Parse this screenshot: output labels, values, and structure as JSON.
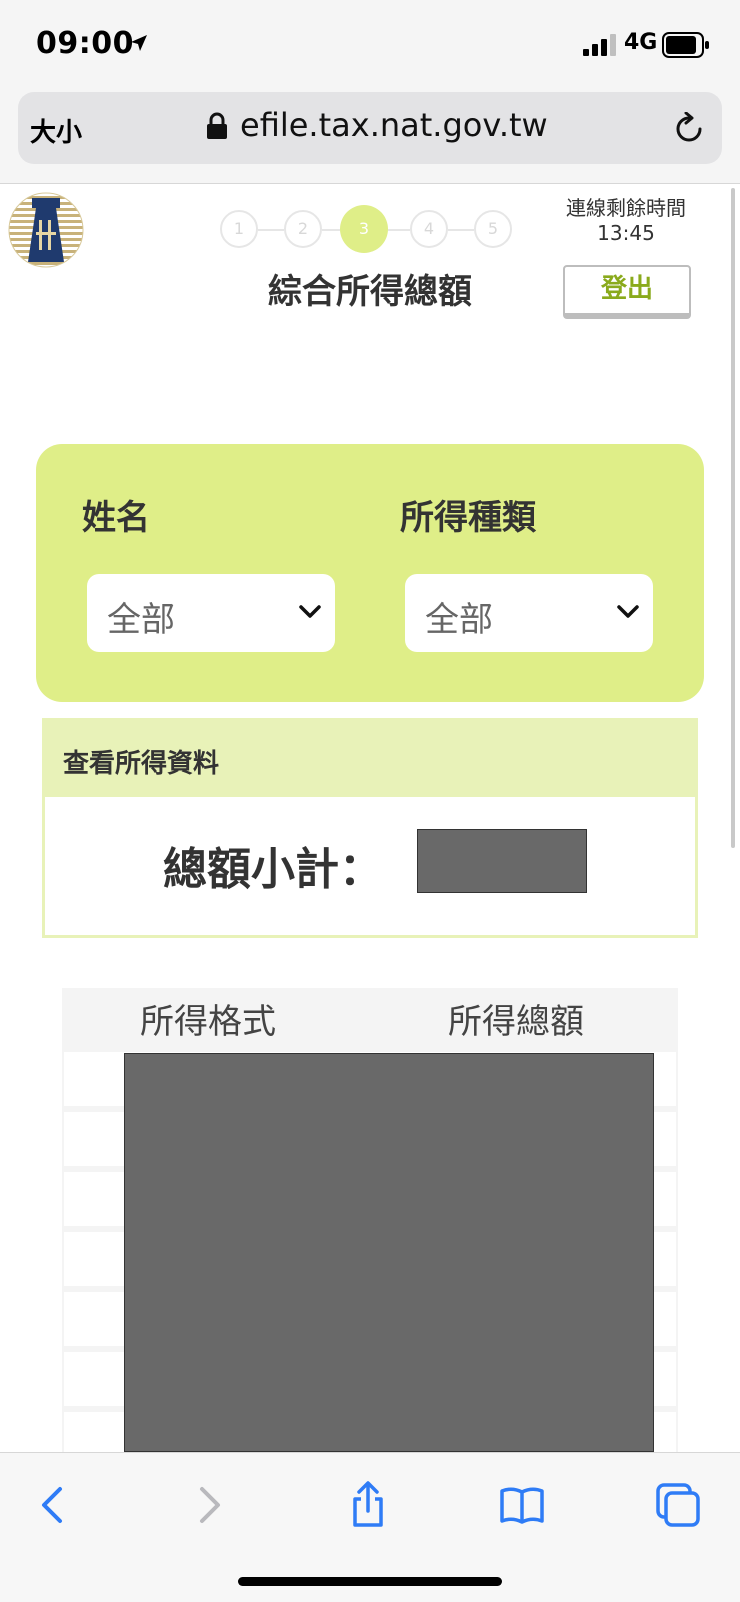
{
  "status_bar": {
    "time": "09:00",
    "network": "4G"
  },
  "browser": {
    "text_size_label": "大小",
    "url": "efile.tax.nat.gov.tw"
  },
  "page": {
    "steps": [
      "1",
      "2",
      "3",
      "4",
      "5"
    ],
    "active_step": 3,
    "title": "綜合所得總額",
    "session_label": "連線剩餘時間",
    "session_remaining": "13:45",
    "logout_label": "登出"
  },
  "filters": {
    "name_label": "姓名",
    "name_value": "全部",
    "type_label": "所得種類",
    "type_value": "全部"
  },
  "income": {
    "section_title": "查看所得資料",
    "subtotal_label": "總額小計："
  },
  "table": {
    "headers": [
      "所得格式",
      "所得總額"
    ]
  },
  "colors": {
    "accent": "#dfee88",
    "accent_light": "#e8f2b8",
    "logout_text": "#8aaa1c",
    "ios_blue": "#2f7cf6",
    "redaction": "#696969"
  },
  "icons": {
    "location": "location-arrow-icon",
    "signal": "cellular-signal-icon",
    "battery": "battery-icon",
    "lock": "lock-icon",
    "reload": "reload-icon",
    "dropdown": "chevron-down-icon",
    "back": "chevron-left-icon",
    "forward": "chevron-right-icon",
    "share": "share-icon",
    "bookmarks": "book-icon",
    "tabs": "tabs-icon"
  }
}
